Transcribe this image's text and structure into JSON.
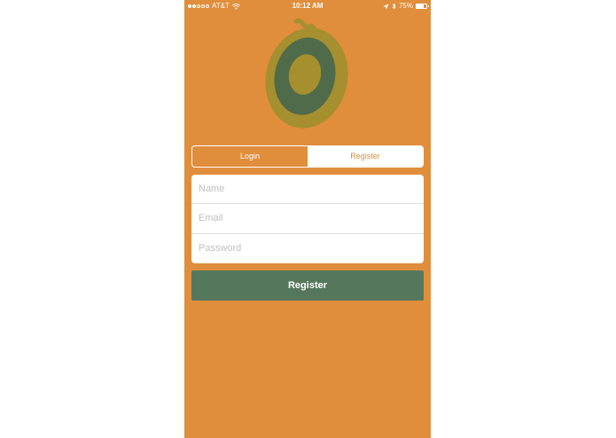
{
  "status_bar": {
    "carrier": "AT&T",
    "time": "10:12 AM",
    "battery": "75%",
    "battery_level": 0.75,
    "signal_bars": 2,
    "signal_total": 5,
    "icons": [
      "wifi-icon",
      "location-arrow-icon",
      "bluetooth-icon",
      "battery-icon"
    ]
  },
  "logo": {
    "icon": "fruit-logo-icon"
  },
  "segment": {
    "login_label": "Login",
    "register_label": "Register",
    "selected": "Login"
  },
  "form": {
    "name_placeholder": "Name",
    "email_placeholder": "Email",
    "password_placeholder": "Password"
  },
  "submit": {
    "label": "Register"
  },
  "colors": {
    "background": "#e08d3c",
    "button": "#55785c",
    "logo_outer": "#a58f2e",
    "logo_ring": "#4f6b4a",
    "logo_inner": "#a58f2e"
  }
}
